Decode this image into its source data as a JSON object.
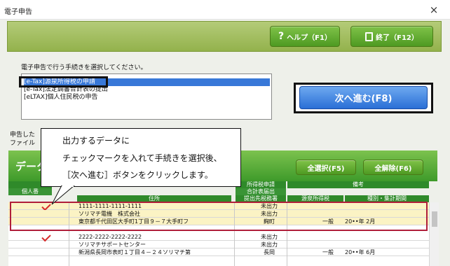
{
  "window": {
    "title": "電子申告",
    "close_glyph": "×"
  },
  "toolbar": {
    "help_label": "ヘルプ（F1）",
    "exit_label": "終了（F12）"
  },
  "prompt": "電子申告で行う手続きを選択してください。",
  "procedures": [
    {
      "label": "[e-Tax]源泉所得税の申請",
      "selected": true
    },
    {
      "label": "[e-Tax]法定調書合計表の提出",
      "selected": false
    },
    {
      "label": "[eLTAX]個人住民税の申告",
      "selected": false
    }
  ],
  "next_button": "次へ進む(F8)",
  "description": {
    "line1": "申告した",
    "line2": "ファイル"
  },
  "data_section": {
    "title": "データ",
    "select_all": "全選択(F5)",
    "deselect_all": "全解除(F6)"
  },
  "columns": {
    "personal_number": "個人番",
    "address": "住所",
    "filing_status": "所得税申請",
    "total_table": "合計表届出",
    "submit_to": "提出先税務署",
    "remarks": "備考",
    "income_tax": "源泉所得税",
    "type_period": "種別・集計期間"
  },
  "rows": [
    {
      "checked": true,
      "corp_number": "1111-1111-1111-1111",
      "name": "ソリマチ電機　株式会社",
      "address": "東京都千代田区大手町1丁目９－７大手町フ",
      "status1": "未出力",
      "status2": "未出力",
      "tax_office": "麹町",
      "type": "一般",
      "period": "20••年 2月"
    },
    {
      "checked": true,
      "corp_number": "2222-2222-2222-2222",
      "name": "ソリマチサポートセンター",
      "address": "新潟県長岡市表町１丁目４－２４ソリマチ第",
      "status1": "未出力",
      "status2": "未出力",
      "tax_office": "長岡",
      "type": "一般",
      "period": "20••年 6月"
    }
  ],
  "callout": {
    "line1": "出力するデータに",
    "line2": "チェックマークを入れて手続きを選択後、",
    "line3": "［次へ進む］ボタンをクリックします。"
  },
  "colors": {
    "accent_green": "#4e9a22",
    "primary_blue": "#2a6fd6",
    "highlight_red": "#b01e3a",
    "check_red": "#d62a2a"
  }
}
